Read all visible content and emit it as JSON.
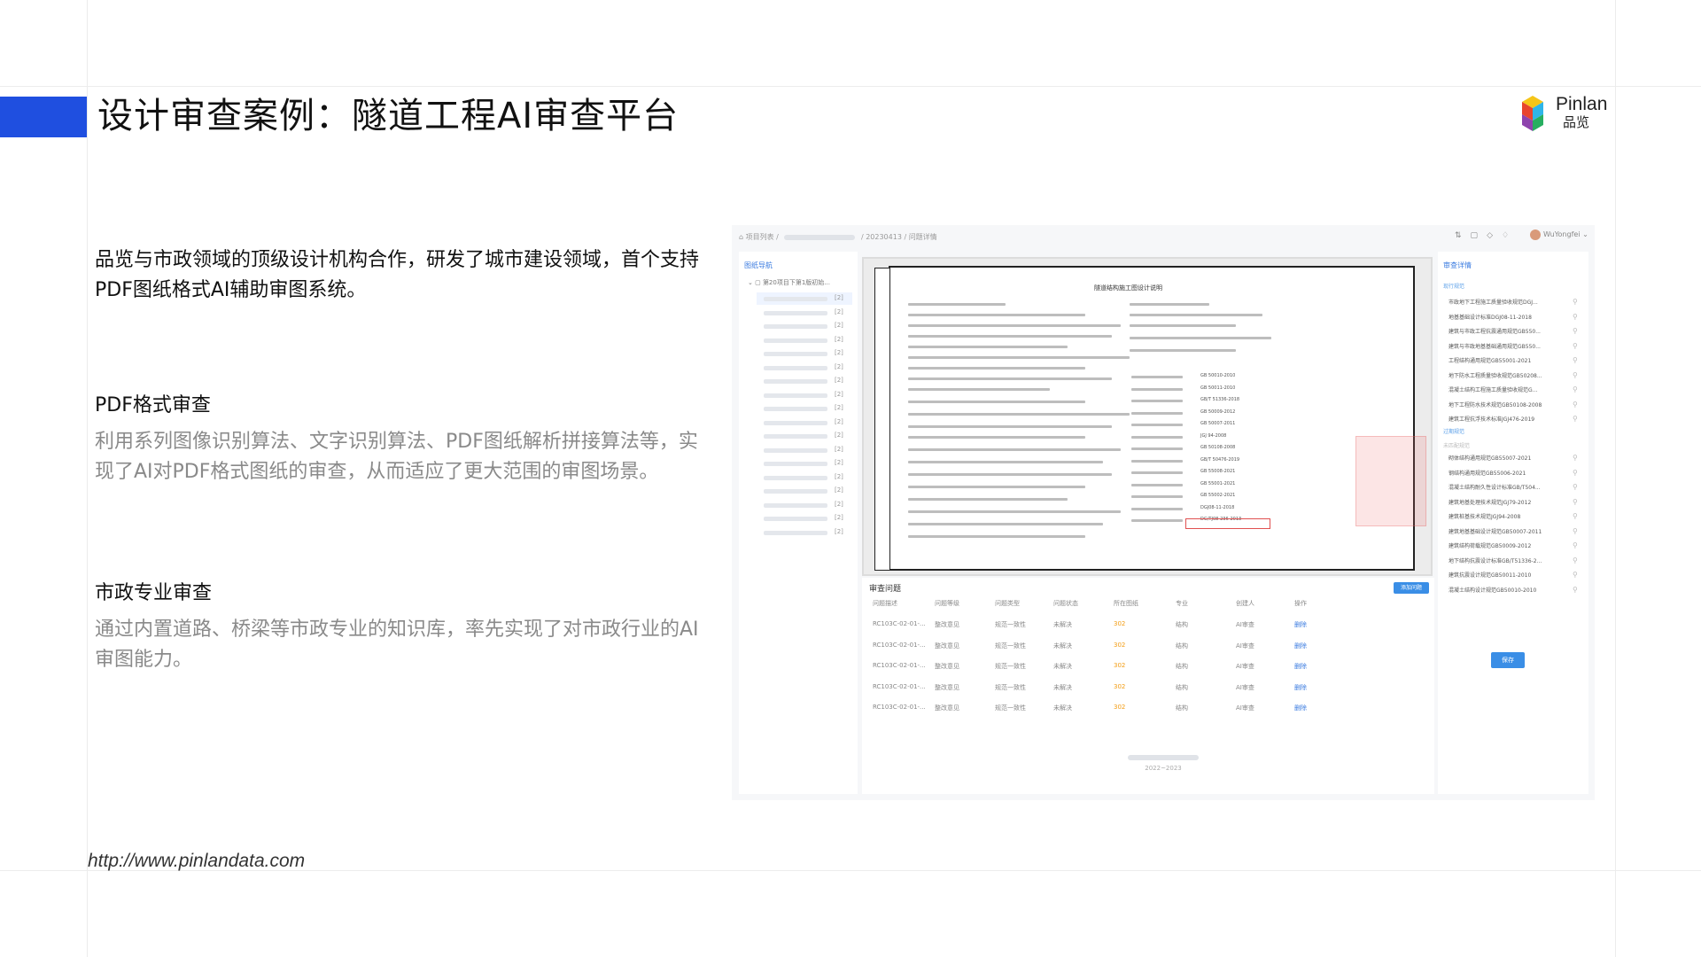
{
  "slide": {
    "title": "设计审查案例：隧道工程AI审查平台",
    "intro": "品览与市政领域的顶级设计机构合作，研发了城市建设领域，首个支持PDF图纸格式AI辅助审图系统。",
    "sections": [
      {
        "title": "PDF格式审查",
        "body": "利用系列图像识别算法、文字识别算法、PDF图纸解析拼接算法等，实现了AI对PDF格式图纸的审查，从而适应了更大范围的审图场景。"
      },
      {
        "title": "市政专业审查",
        "body": "通过内置道路、桥梁等市政专业的知识库，率先实现了对市政行业的AI审图能力。"
      }
    ],
    "footer_url": "http://www.pinlandata.com"
  },
  "logo": {
    "en": "Pinlan",
    "cn": "品览"
  },
  "colors": {
    "accent": "#1f4fe0",
    "link": "#3a7be0",
    "button": "#3a8ee6",
    "warning": "#f39c12"
  },
  "screenshot": {
    "breadcrumb": {
      "project_list": "项目列表",
      "date": "20230413",
      "page": "问题详情"
    },
    "user": "WuYongfei",
    "left_panel": {
      "title": "图纸导航",
      "root": "第20项目下第1版初始...",
      "tag": "[2]"
    },
    "drawing": {
      "sheet_title": "隧道结构施工图设计说明",
      "standards": [
        "GB 50010-2010",
        "GB 50011-2010",
        "GB/T 51336-2018",
        "GB 50009-2012",
        "GB 50007-2011",
        "JGJ 94-2008",
        "GB 50108-2008",
        "GB/T 50476-2019",
        "GB 55008-2021",
        "GB 55001-2021",
        "GB 55002-2021",
        "DGJ08-11-2018",
        "DG/TJ08-236-2013"
      ]
    },
    "issues": {
      "title": "审查问题",
      "add_button": "添加问题",
      "columns": [
        "问题描述",
        "问题等级",
        "问题类型",
        "问题状态",
        "所在图纸",
        "专业",
        "创建人",
        "操作"
      ],
      "rows": [
        [
          "RC103C-02-01-...",
          "整改意见",
          "规范一致性",
          "未解决",
          "302",
          "结构",
          "AI审查",
          "删除"
        ],
        [
          "RC103C-02-01-...",
          "整改意见",
          "规范一致性",
          "未解决",
          "302",
          "结构",
          "AI审查",
          "删除"
        ],
        [
          "RC103C-02-01-...",
          "整改意见",
          "规范一致性",
          "未解决",
          "302",
          "结构",
          "AI审查",
          "删除"
        ],
        [
          "RC103C-02-01-...",
          "整改意见",
          "规范一致性",
          "未解决",
          "302",
          "结构",
          "AI审查",
          "删除"
        ],
        [
          "RC103C-02-01-...",
          "整改意见",
          "规范一致性",
          "未解决",
          "302",
          "结构",
          "AI审查",
          "删除"
        ]
      ]
    },
    "right_panel": {
      "title": "审查详情",
      "group1": "现行规范",
      "group1_items": [
        "市政地下工程施工质量验收规范DGJ...",
        "地基基础设计标准DGJ08-11-2018",
        "建筑与市政工程抗震通用规范GB550...",
        "建筑与市政地基基础通用规范GB550...",
        "工程结构通用规范GB55001-2021",
        "地下防水工程质量验收规范GB50208...",
        "混凝土结构工程施工质量验收规范G...",
        "地下工程防水技术规范GB50108-2008",
        "建筑工程抗浮技术标准JGJ476-2019"
      ],
      "group2": "过期规范",
      "group2_note": "未匹配规范",
      "group3_items": [
        "砌体结构通用规范GB55007-2021",
        "钢结构通用规范GB55006-2021",
        "混凝土结构耐久性设计标准GB/T504...",
        "建筑地基处理技术规范JGJ79-2012",
        "建筑桩基技术规范JGJ94-2008",
        "建筑地基基础设计规范GB50007-2011",
        "建筑结构荷载规范GB50009-2012",
        "地下结构抗震设计标准GB/T51336-2...",
        "建筑抗震设计规范GB50011-2010",
        "混凝土结构设计规范GB50010-2010"
      ],
      "save_button": "保存"
    },
    "footer_year": "2022~2023"
  }
}
